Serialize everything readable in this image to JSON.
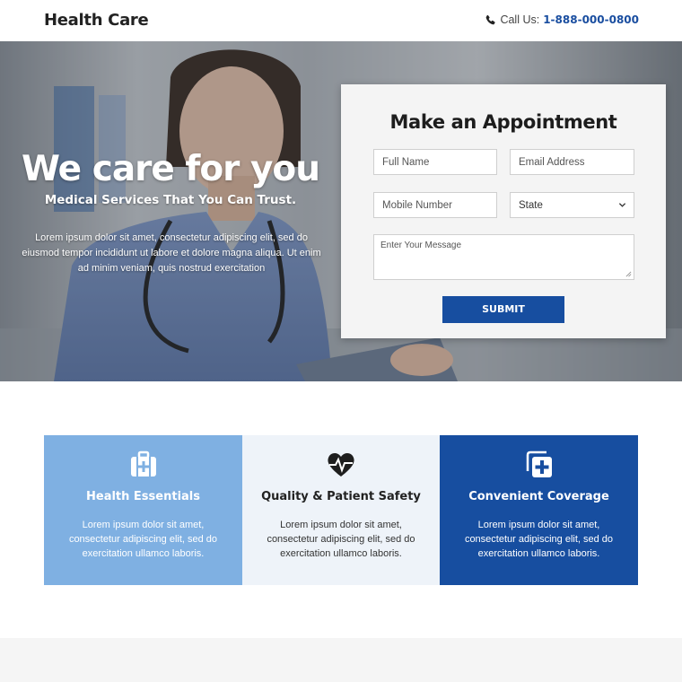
{
  "header": {
    "brand": "Health Care",
    "call_label": "Call Us:",
    "phone": "1-888-000-0800"
  },
  "hero": {
    "title": "We care for you",
    "subtitle": "Medical Services That You Can Trust.",
    "body": "Lorem ipsum dolor sit amet, consectetur adipiscing elit, sed do eiusmod tempor incididunt ut labore et dolore magna aliqua. Ut enim ad minim veniam, quis nostrud exercitation"
  },
  "form": {
    "title": "Make an Appointment",
    "full_name_placeholder": "Full Name",
    "email_placeholder": "Email Address",
    "mobile_placeholder": "Mobile Number",
    "state_value": "State",
    "message_placeholder": "Enter Your Message",
    "submit_label": "SUBMIT"
  },
  "features": [
    {
      "title": "Health Essentials",
      "text": "Lorem ipsum dolor sit amet, consectetur adipiscing elit, sed do exercitation ullamco laboris.",
      "icon": "medical-kit-icon"
    },
    {
      "title": "Quality & Patient Safety",
      "text": "Lorem ipsum dolor sit amet, consectetur adipiscing elit, sed do exercitation ullamco laboris.",
      "icon": "heartbeat-icon"
    },
    {
      "title": "Convenient Coverage",
      "text": "Lorem ipsum dolor sit amet, consectetur adipiscing elit, sed do exercitation ullamco laboris.",
      "icon": "medical-plus-icon"
    }
  ],
  "colors": {
    "brand_blue": "#174ea0",
    "light_blue": "#7fb0e2",
    "pale_blue": "#eef3f9"
  }
}
